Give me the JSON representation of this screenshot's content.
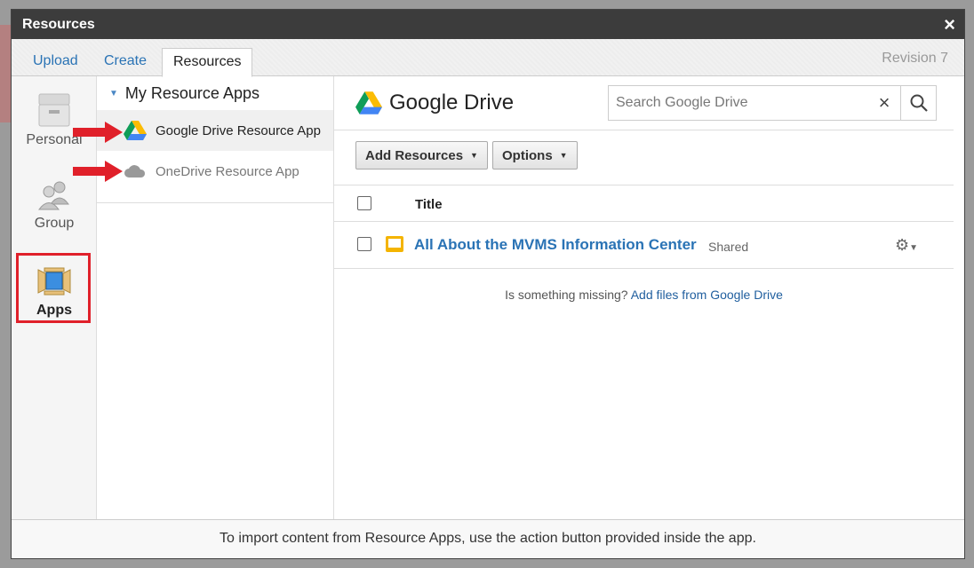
{
  "dialog": {
    "title": "Resources",
    "close_label": "×"
  },
  "tabs": [
    {
      "label": "Upload"
    },
    {
      "label": "Create"
    },
    {
      "label": "Resources"
    }
  ],
  "revision": "Revision 7",
  "leftnav": {
    "personal": "Personal",
    "group": "Group",
    "apps": "Apps"
  },
  "apps_panel": {
    "heading": "My Resource Apps",
    "items": [
      {
        "label": "Google Drive Resource App"
      },
      {
        "label": "OneDrive Resource App"
      }
    ]
  },
  "main": {
    "title": "Google Drive",
    "search": {
      "placeholder": "Search Google Drive",
      "clear": "×"
    },
    "add_resources": "Add Resources",
    "options": "Options",
    "column_title": "Title",
    "rows": [
      {
        "title": "All About the MVMS Information Center",
        "status": "Shared"
      }
    ],
    "missing_text": "Is something missing?",
    "missing_link": "Add files from Google Drive"
  },
  "footer": "To import content from Resource Apps, use the action button provided inside the app.",
  "colors": {
    "accent": "#2a73b5",
    "highlight": "#e0202a",
    "titlebar": "#3c3c3c"
  }
}
